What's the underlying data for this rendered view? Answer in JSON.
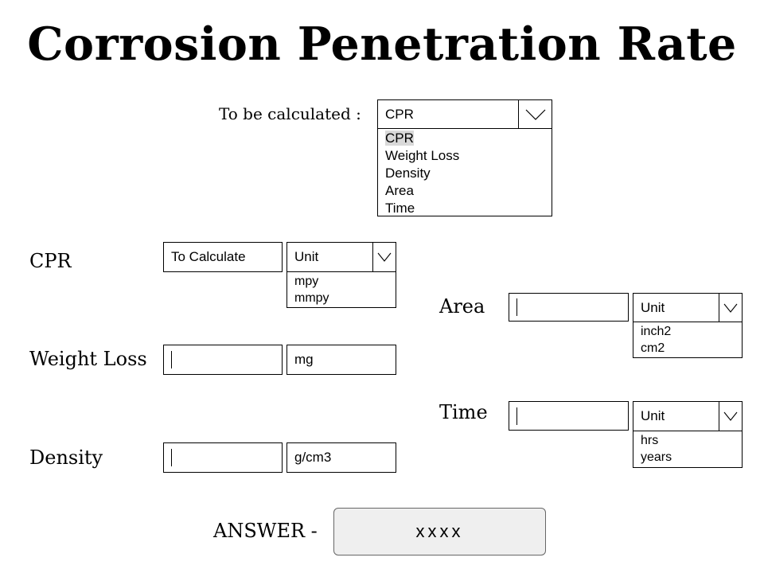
{
  "title": "Corrosion Penetration Rate",
  "calculate_selector": {
    "label": "To be calculated :",
    "selected": "CPR",
    "options": [
      "CPR",
      "Weight Loss",
      "Density",
      "Area",
      "Time"
    ]
  },
  "fields": {
    "cpr": {
      "label": "CPR",
      "value": "To Calculate",
      "unit_selected": "Unit",
      "unit_options": [
        "mpy",
        "mmpy"
      ]
    },
    "weight_loss": {
      "label": "Weight Loss",
      "value": "",
      "unit": "mg"
    },
    "density": {
      "label": "Density",
      "value": "",
      "unit": "g/cm3"
    },
    "area": {
      "label": "Area",
      "value": "",
      "unit_selected": "Unit",
      "unit_options": [
        "inch2",
        "cm2"
      ]
    },
    "time": {
      "label": "Time",
      "value": "",
      "unit_selected": "Unit",
      "unit_options": [
        "hrs",
        "years"
      ]
    }
  },
  "answer": {
    "label": "ANSWER -",
    "value": "xxxx"
  },
  "icons": {
    "dropdown": "chevron-down-icon"
  },
  "colors": {
    "highlight": "#d9d9d9",
    "answer_bg": "#efefef",
    "border": "#000000"
  }
}
